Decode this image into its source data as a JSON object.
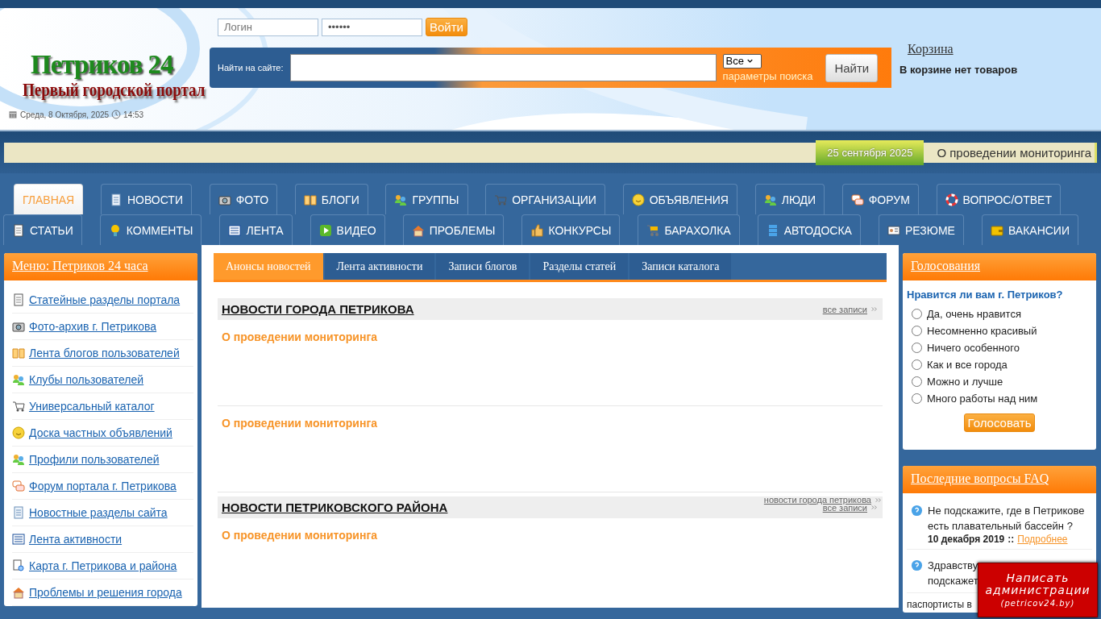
{
  "header": {
    "logo_title": "Петриков 24",
    "logo_subtitle": "Первый городской портал",
    "date": "Среда, 8 Октября, 2025",
    "time": "14:53"
  },
  "login": {
    "login_placeholder": "Логин",
    "password_value": "••••••",
    "button": "Войти"
  },
  "search": {
    "label": "Найти на сайте:",
    "scope": "Все",
    "params_link": "параметры поиска",
    "button": "Найти"
  },
  "cart": {
    "title": "Корзина",
    "status": "В корзине нет товаров"
  },
  "ticker": {
    "date": "25 сентября 2025",
    "text": "О проведении мониторинга"
  },
  "nav_rows": [
    [
      {
        "label": "ГЛАВНАЯ",
        "selected": true
      },
      {
        "label": "НОВОСТИ",
        "selected": false
      },
      {
        "label": "ФОТО",
        "selected": false
      },
      {
        "label": "БЛОГИ",
        "selected": false
      },
      {
        "label": "ГРУППЫ",
        "selected": false
      },
      {
        "label": "ОРГАНИЗАЦИИ",
        "selected": false
      },
      {
        "label": "ОБЪЯВЛЕНИЯ",
        "selected": false
      },
      {
        "label": "ЛЮДИ",
        "selected": false
      },
      {
        "label": "ФОРУМ",
        "selected": false
      },
      {
        "label": "ВОПРОС/ОТВЕТ",
        "selected": false
      }
    ],
    [
      {
        "label": "СТАТЬИ",
        "selected": false
      },
      {
        "label": "КОММЕНТЫ",
        "selected": false
      },
      {
        "label": "ЛЕНТА",
        "selected": false
      },
      {
        "label": "ВИДЕО",
        "selected": false
      },
      {
        "label": "ПРОБЛЕМЫ",
        "selected": false
      },
      {
        "label": "КОНКУРСЫ",
        "selected": false
      },
      {
        "label": "БАРАХОЛКА",
        "selected": false
      },
      {
        "label": "АВТОДОСКА",
        "selected": false
      },
      {
        "label": "РЕЗЮМЕ",
        "selected": false
      },
      {
        "label": "ВАКАНСИИ",
        "selected": false
      }
    ]
  ],
  "side_menu": {
    "title": "Меню: Петриков 24 часа",
    "items": [
      "Статейные разделы портала",
      "Фото-архив г. Петрикова",
      "Лента блогов пользователей",
      "Клубы пользователей",
      "Универсальный каталог",
      "Доска частных объявлений",
      "Профили пользователей",
      "Форум портала г. Петрикова",
      "Новостные разделы сайта",
      "Лента активности",
      "Карта г. Петрикова и района",
      "Проблемы и решения города"
    ]
  },
  "content_tabs": [
    {
      "label": "Анонсы новостей",
      "selected": true
    },
    {
      "label": "Лента активности",
      "selected": false
    },
    {
      "label": "Записи блогов",
      "selected": false
    },
    {
      "label": "Разделы статей",
      "selected": false
    },
    {
      "label": "Записи каталога",
      "selected": false
    }
  ],
  "sections": [
    {
      "title": "НОВОСТИ ГОРОДА ПЕТРИКОВА",
      "all_link": "все записи",
      "items": [
        "О проведении мониторинга",
        "О проведении мониторинга"
      ],
      "footer_link": "новости города петрикова"
    },
    {
      "title": "НОВОСТИ ПЕТРИКОВСКОГО РАЙОНА",
      "all_link": "все записи",
      "items": [
        "О проведении мониторинга"
      ]
    }
  ],
  "poll": {
    "title": "Голосования",
    "question": "Нравится ли вам г. Петриков?",
    "options": [
      {
        "label": "Да, очень нравится",
        "selected": false
      },
      {
        "label": "Несомненно красивый",
        "selected": false
      },
      {
        "label": "Ничего особенного",
        "selected": false
      },
      {
        "label": "Как и все города",
        "selected": false
      },
      {
        "label": "Можно и лучше",
        "selected": false
      },
      {
        "label": "Много работы над ним",
        "selected": false
      }
    ],
    "button": "Голосовать"
  },
  "faq": {
    "title": "Последние вопросы FAQ",
    "items": [
      {
        "lines": [
          "Не подскажите, где в Петрикове есть плавательный бассейн ?"
        ],
        "date": "10 декабря 2019",
        "separator": "::",
        "more": "Подробнее"
      },
      {
        "lines": [
          "Здравству",
          "подскажет"
        ],
        "tail": "паспортисты в"
      }
    ]
  },
  "admin_button": {
    "line1": "Написать",
    "line2": "администрации",
    "site": "(petricov24.by)"
  }
}
